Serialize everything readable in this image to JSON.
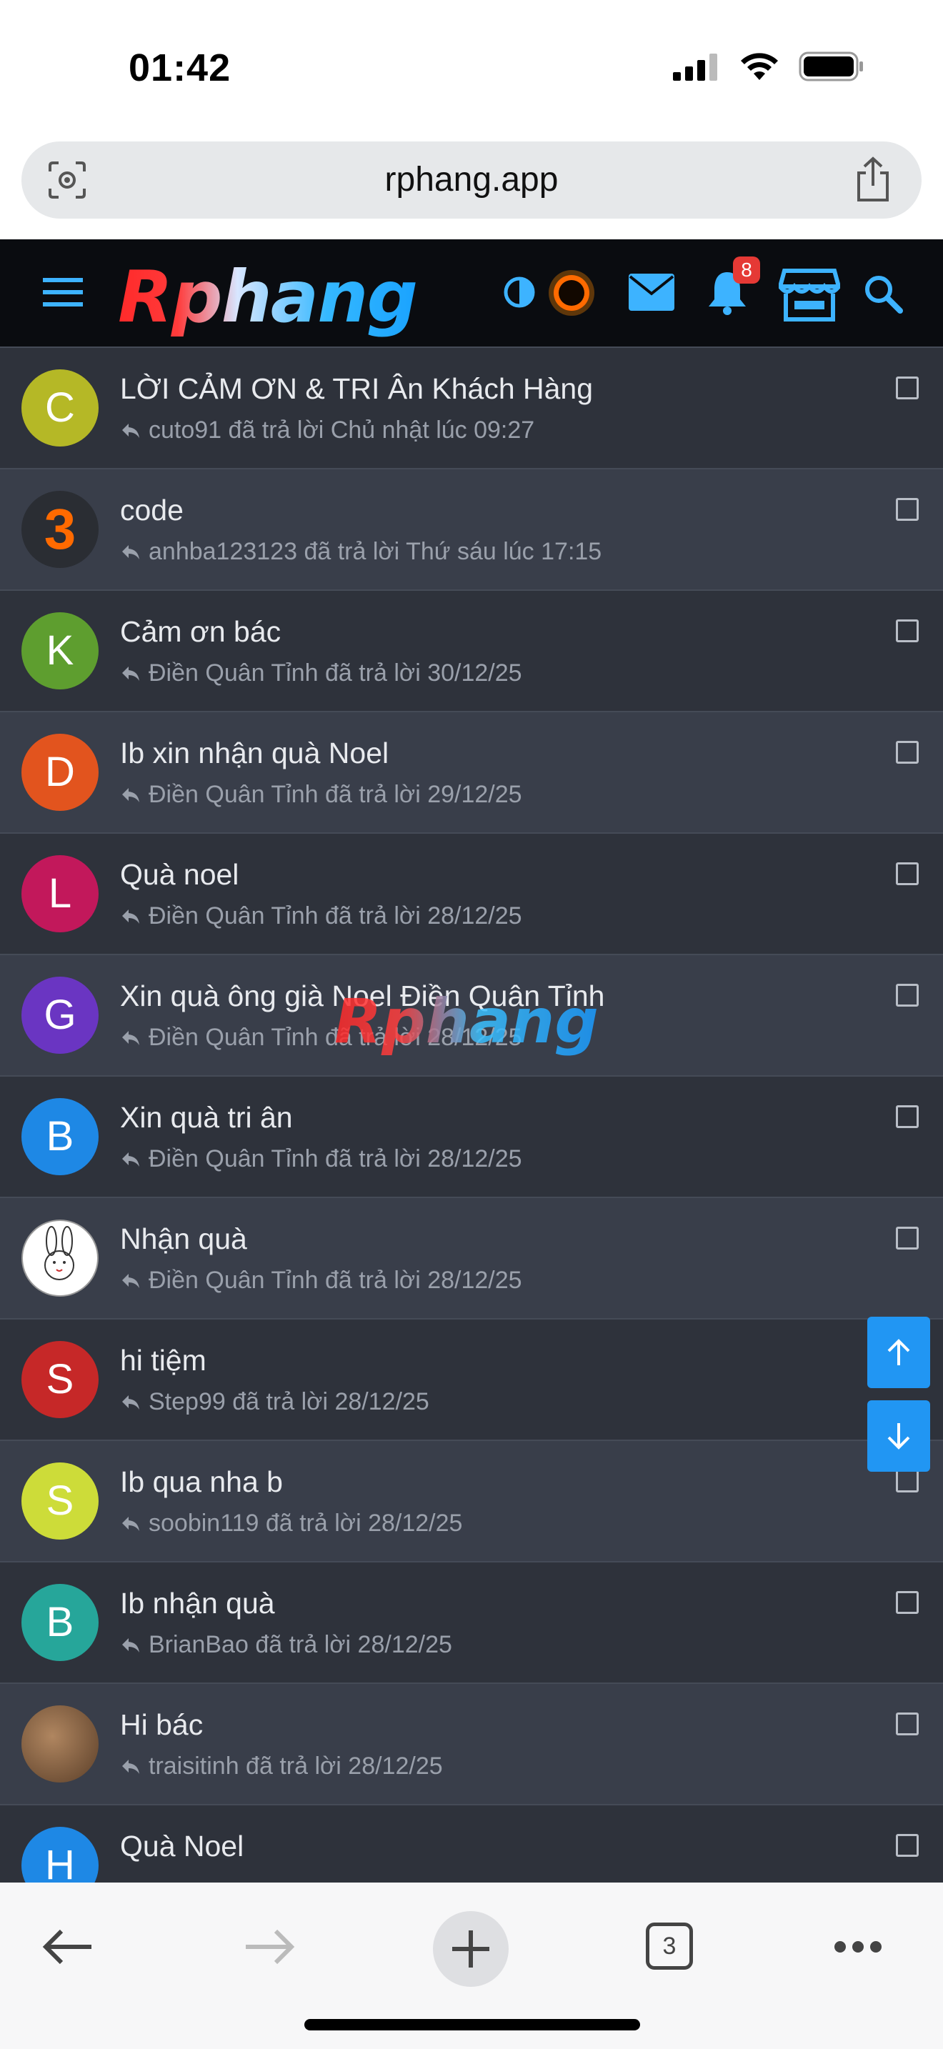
{
  "status_bar": {
    "time": "01:42"
  },
  "browser": {
    "url": "rphang.app",
    "tab_count": "3"
  },
  "header": {
    "logo_text": "Rphang",
    "notification_count": "8"
  },
  "watermark": "Rphang",
  "threads": [
    {
      "avatar_letter": "C",
      "avatar_color": "#b5b826",
      "title": "LỜI CẢM ƠN & TRI Ân Khách Hàng",
      "meta": "cuto91 đã trả lời Chủ nhật lúc 09:27"
    },
    {
      "avatar_letter": "3",
      "avatar_color": "#2a2d33",
      "title": "code",
      "meta": "anhba123123 đã trả lời Thứ sáu lúc 17:15"
    },
    {
      "avatar_letter": "K",
      "avatar_color": "#5e9e2f",
      "title": "Cảm ơn bác",
      "meta": "Điền Quân Tỉnh đã trả lời 30/12/25"
    },
    {
      "avatar_letter": "D",
      "avatar_color": "#e2541e",
      "title": "Ib xin nhận quà Noel",
      "meta": "Điền Quân Tỉnh đã trả lời 29/12/25"
    },
    {
      "avatar_letter": "L",
      "avatar_color": "#c2185b",
      "title": "Quà noel",
      "meta": "Điền Quân Tỉnh đã trả lời 28/12/25"
    },
    {
      "avatar_letter": "G",
      "avatar_color": "#6a35c2",
      "title": "Xin quà ông già Noel Điền Quân Tỉnh",
      "meta": "Điền Quân Tỉnh đã trả lời 28/12/25"
    },
    {
      "avatar_letter": "B",
      "avatar_color": "#1e88e5",
      "title": "Xin quà tri ân",
      "meta": "Điền Quân Tỉnh đã trả lời 28/12/25"
    },
    {
      "avatar_letter": "",
      "avatar_color": "#ffffff",
      "title": "Nhận quà",
      "meta": "Điền Quân Tỉnh đã trả lời 28/12/25"
    },
    {
      "avatar_letter": "S",
      "avatar_color": "#c62828",
      "title": "hi tiệm",
      "meta": "Step99 đã trả lời 28/12/25"
    },
    {
      "avatar_letter": "S",
      "avatar_color": "#cddc39",
      "title": "Ib qua nha b",
      "meta": "soobin119 đã trả lời 28/12/25"
    },
    {
      "avatar_letter": "B",
      "avatar_color": "#26a69a",
      "title": "Ib nhận quà",
      "meta": "BrianBao đã trả lời 28/12/25"
    },
    {
      "avatar_letter": "",
      "avatar_color": "#8a6a4a",
      "title": "Hi bác",
      "meta": "traisitinh đã trả lời 28/12/25"
    },
    {
      "avatar_letter": "H",
      "avatar_color": "#1e88e5",
      "title": "Quà Noel",
      "meta": ""
    }
  ]
}
